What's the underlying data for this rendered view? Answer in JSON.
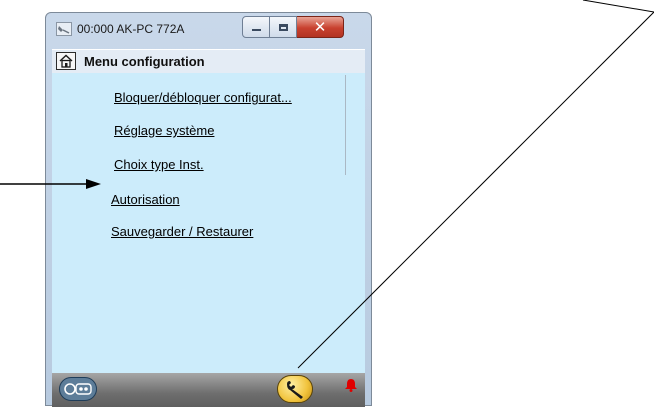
{
  "window": {
    "title": "00:000 AK-PC 772A",
    "controls": {
      "minimize": "minimize-icon",
      "maximize": "maximize-icon",
      "close": "✕"
    }
  },
  "menu": {
    "title": "Menu configuration",
    "home_icon": "home-icon",
    "items": [
      {
        "label": "Bloquer/débloquer configurat..."
      },
      {
        "label": "Réglage système"
      },
      {
        "label": "Choix type Inst."
      },
      {
        "label": "Autorisation"
      },
      {
        "label": "Sauvegarder / Restaurer"
      }
    ]
  },
  "bottom_bar": {
    "left_button": "key-icon",
    "center_button": "wrench-icon",
    "right_indicator": "bell-icon"
  },
  "colors": {
    "content_bg": "#ccecfb",
    "close_button": "#c8412f",
    "wrench_button": "#f1c33c",
    "alarm": "#e00000",
    "key_button": "#5d7d99"
  }
}
